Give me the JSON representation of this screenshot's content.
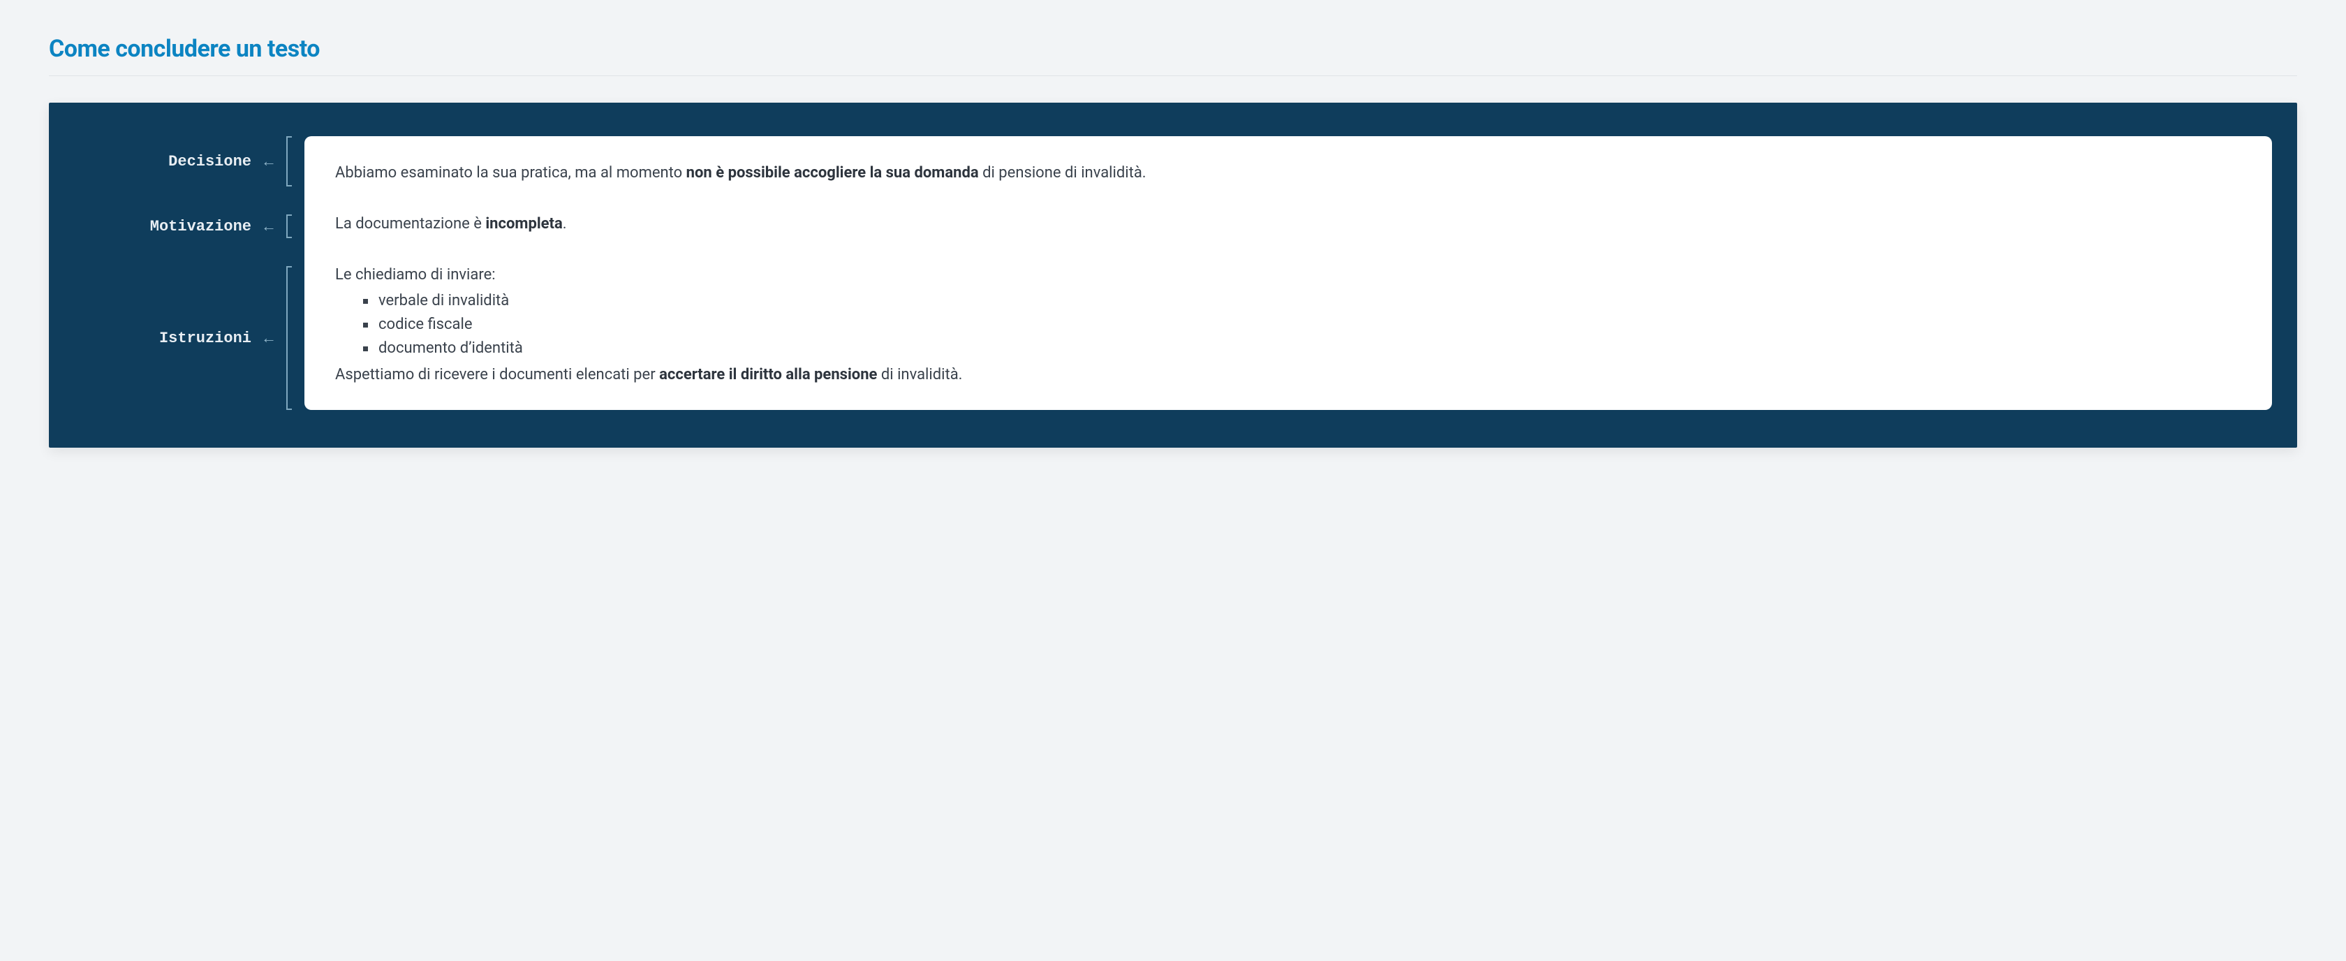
{
  "title": "Come concludere un testo",
  "labels": {
    "decisione": "Decisione",
    "motivazione": "Motivazione",
    "istruzioni": "Istruzioni"
  },
  "arrow": "←",
  "sections": {
    "decisione": {
      "pre": "Abbiamo esaminato la sua pratica, ma al momento ",
      "bold": "non è possibile accogliere la sua domanda",
      "post": " di pensione di invalidità."
    },
    "motivazione": {
      "pre": "La documentazione è ",
      "bold": "incompleta",
      "post": "."
    },
    "istruzioni": {
      "lead": "Le chiediamo di inviare:",
      "items": [
        "verbale di invalidità",
        "codice fiscale",
        "documento d’identità"
      ],
      "trail_pre": "Aspettiamo di ricevere i documenti elencati per ",
      "trail_bold": "accertare il diritto alla pensione",
      "trail_post": " di invalidità."
    }
  }
}
